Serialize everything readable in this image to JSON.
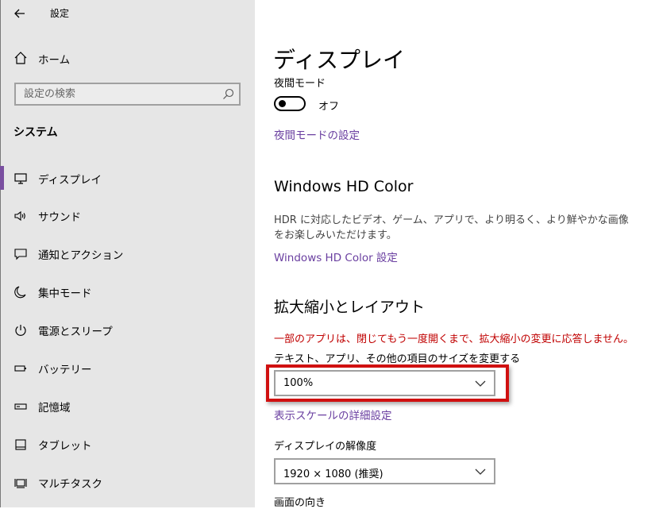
{
  "window": {
    "title": "設定"
  },
  "sidebar": {
    "home_label": "ホーム",
    "search_placeholder": "設定の検索",
    "section_title": "システム",
    "items": [
      {
        "label": "ディスプレイ",
        "icon": "monitor-icon",
        "selected": true
      },
      {
        "label": "サウンド",
        "icon": "speaker-icon",
        "selected": false
      },
      {
        "label": "通知とアクション",
        "icon": "notification-icon",
        "selected": false
      },
      {
        "label": "集中モード",
        "icon": "moon-icon",
        "selected": false
      },
      {
        "label": "電源とスリープ",
        "icon": "power-icon",
        "selected": false
      },
      {
        "label": "バッテリー",
        "icon": "battery-icon",
        "selected": false
      },
      {
        "label": "記憶域",
        "icon": "storage-icon",
        "selected": false
      },
      {
        "label": "タブレット",
        "icon": "tablet-icon",
        "selected": false
      },
      {
        "label": "マルチタスク",
        "icon": "multitask-icon",
        "selected": false
      }
    ]
  },
  "main": {
    "title": "ディスプレイ",
    "night_mode": {
      "label": "夜間モード",
      "toggle_state": "オフ",
      "settings_link": "夜間モードの設定"
    },
    "hd_color": {
      "heading": "Windows HD Color",
      "description": "HDR に対応したビデオ、ゲーム、アプリで、より明るく、より鮮やかな画像をお楽しみいただけます。",
      "link": "Windows HD Color 設定"
    },
    "scale_layout": {
      "heading": "拡大縮小とレイアウト",
      "warning": "一部のアプリは、閉じてもう一度開くまで、拡大縮小の変更に応答しません。",
      "scale_label": "テキスト、アプリ、その他の項目のサイズを変更する",
      "scale_value": "100%",
      "advanced_link": "表示スケールの詳細設定",
      "resolution_label": "ディスプレイの解像度",
      "resolution_value": "1920 × 1080 (推奨)",
      "orientation_label": "画面の向き"
    }
  },
  "colors": {
    "accent": "#6a3fa0",
    "warning": "#c00000",
    "highlight": "#d01010",
    "sidebar_bg": "#e6e6e6"
  }
}
